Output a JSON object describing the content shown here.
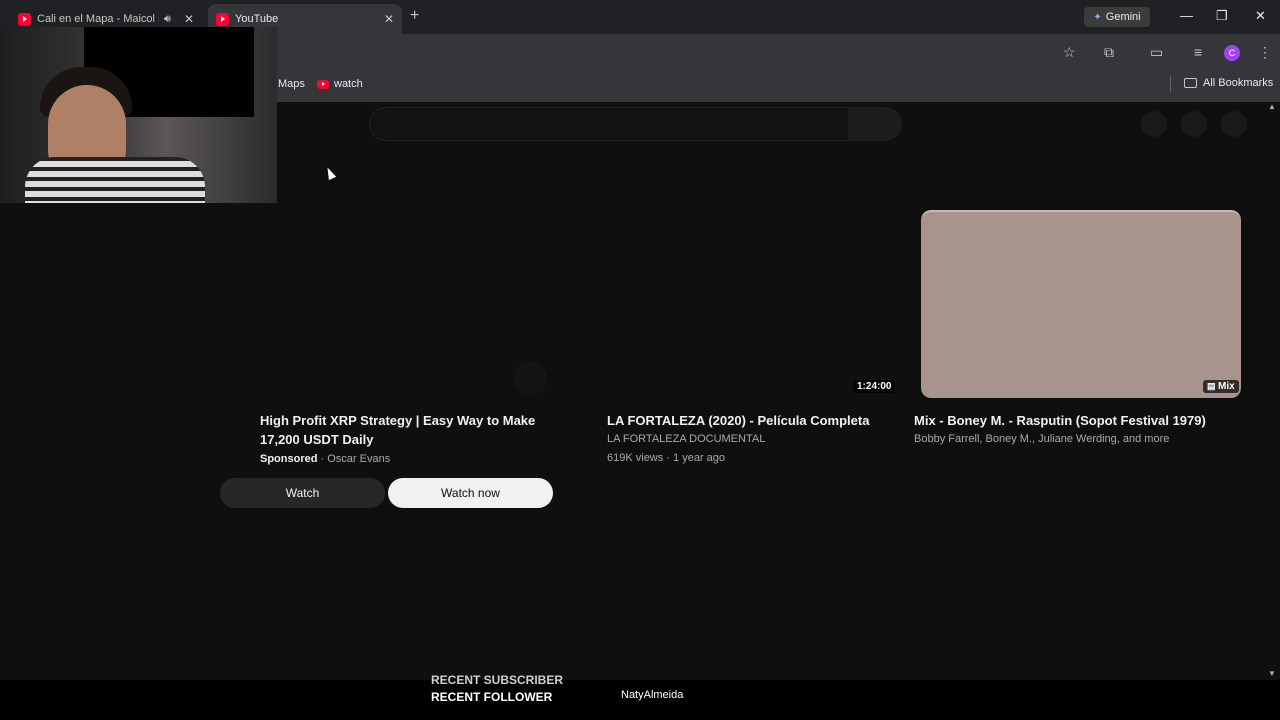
{
  "browser": {
    "tabs": [
      {
        "title": "Cali en el Mapa - Maicol La",
        "audio": "speaker-icon"
      },
      {
        "title": "YouTube",
        "active": true
      }
    ],
    "gemini_label": "Gemini",
    "avatar_letter": "C",
    "bookmarks": [
      "Maps",
      "watch"
    ],
    "all_bookmarks_label": "All Bookmarks"
  },
  "feed": {
    "cards": [
      {
        "title": "High Profit XRP Strategy | Easy Way to Make 17,200 USDT Daily",
        "sponsored_label": "Sponsored",
        "channel": "· Oscar Evans",
        "watch_label": "Watch",
        "watch_now_label": "Watch now"
      },
      {
        "title": "LA FORTALEZA (2020) - Película Completa",
        "channel": "LA FORTALEZA DOCUMENTAL",
        "stats": "619K views · 1 year ago",
        "duration": "1:24:00"
      },
      {
        "title": "Mix - Boney M. - Rasputin (Sopot Festival 1979)",
        "channel": "Bobby Farrell, Boney M., Juliane Werding, and more",
        "badge": "Mix"
      }
    ]
  },
  "stream_overlay": {
    "recent_subscriber_label": "RECENT SUBSCRIBER",
    "recent_follower_label": "RECENT FOLLOWER",
    "recent_follower_name": "NatyAlmeida"
  },
  "colors": {
    "background": "#0f0f0f",
    "chrome_frame": "#202124",
    "toolbar": "#35363a",
    "youtube_red": "#ff0033",
    "mix_thumbnail": "#a8948d"
  }
}
